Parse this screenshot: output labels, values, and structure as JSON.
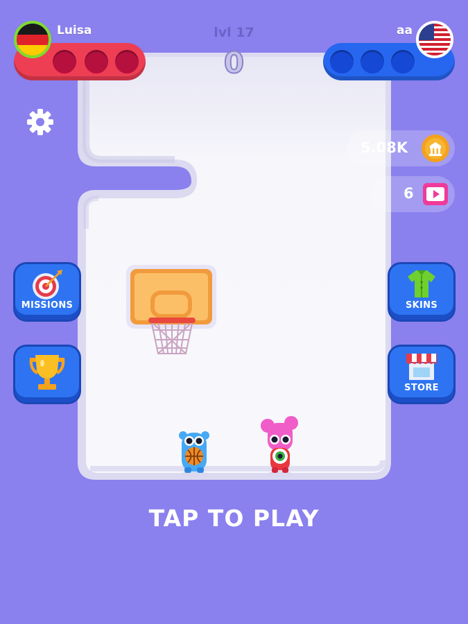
{
  "players": {
    "left": {
      "name": "Luisa",
      "flag": "germany-flag",
      "color": "#ee3e53"
    },
    "right": {
      "name": "aa",
      "flag": "usa-flag",
      "color": "#2767f0"
    }
  },
  "level": {
    "label": "lvl 17"
  },
  "score": {
    "value": "0"
  },
  "currency": {
    "coins": "5.08K",
    "tickets": "6"
  },
  "menu": {
    "missions": "MISSIONS",
    "skins": "SKINS",
    "store": "STORE"
  },
  "prompt": {
    "tap": "TAP TO PLAY"
  },
  "colors": {
    "background": "#8a80ee",
    "button": "#2e74f2",
    "court": "#f4f4fa"
  }
}
